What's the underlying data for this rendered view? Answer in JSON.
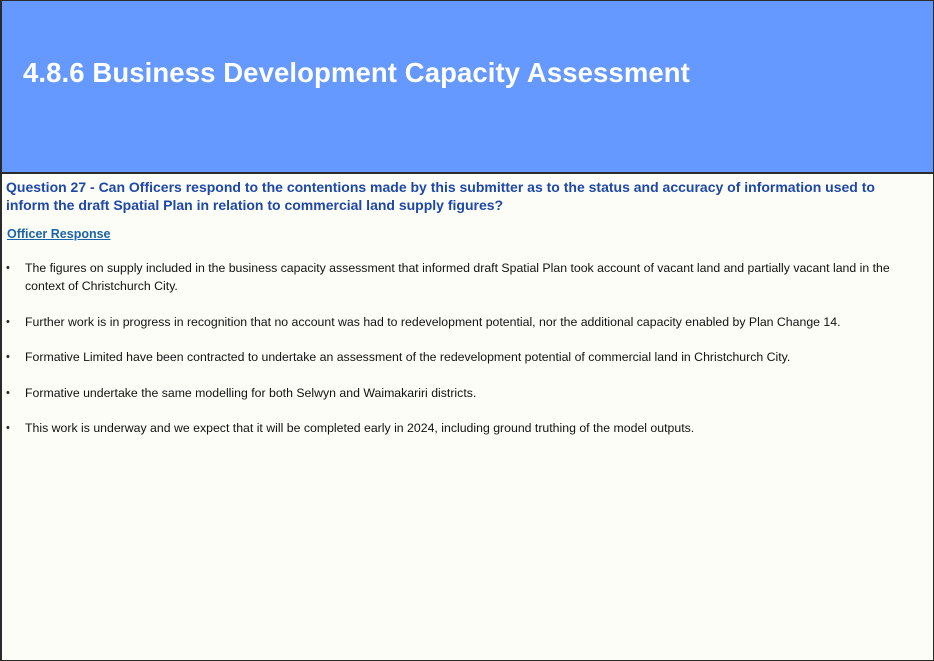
{
  "slide": {
    "title": "4.8.6 Business Development Capacity Assessment",
    "question": "Question 27 - Can Officers respond to the contentions made by this submitter as to the status and accuracy of information used to inform the draft Spatial Plan in relation to commercial land supply figures?",
    "response_heading": "Officer Response",
    "bullet_glyph": "•",
    "bullets": [
      "The figures on supply included in the business capacity assessment that informed draft Spatial Plan took account of vacant land and partially vacant land in the context of Christchurch City.",
      "Further work is in progress in recognition that no account was had to redevelopment potential, nor the additional capacity enabled by Plan Change 14.",
      "Formative Limited have been contracted to undertake an assessment of the redevelopment potential of commercial land in Christchurch City.",
      "Formative undertake the same modelling for both Selwyn and Waimakariri districts.",
      "This work is underway and we expect that it will be completed early in 2024, including ground truthing of the model outputs."
    ]
  },
  "colors": {
    "title_band": "#6699ff",
    "title_text": "#ffffff",
    "question_text": "#1d47a8",
    "response_heading": "#1a63a8",
    "body_text": "#111111",
    "slide_background": "#fdfdf8"
  }
}
